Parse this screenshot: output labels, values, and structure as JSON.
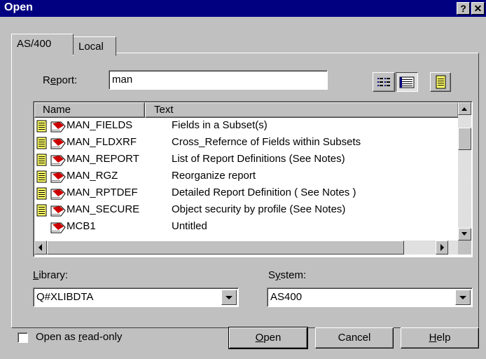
{
  "window": {
    "title": "Open",
    "help_glyph": "?",
    "close_glyph": "✕"
  },
  "tabs": [
    {
      "label": "AS/400"
    },
    {
      "label": "Local"
    }
  ],
  "report": {
    "label_pre": "R",
    "label_ul": "e",
    "label_post": "port:",
    "value": "man"
  },
  "view_icons": [
    "list-view-icon",
    "details-view-icon",
    "properties-icon"
  ],
  "list": {
    "headers": {
      "name": "Name",
      "text": "Text"
    },
    "rows": [
      {
        "name": "MAN_FIELDS",
        "text": "Fields in a Subset(s)"
      },
      {
        "name": "MAN_FLDXRF",
        "text": "Cross_Refernce of Fields within Subsets"
      },
      {
        "name": "MAN_REPORT",
        "text": "List of Report Definitions   (See Notes)"
      },
      {
        "name": "MAN_RGZ",
        "text": "Reorganize report"
      },
      {
        "name": "MAN_RPTDEF",
        "text": "Detailed Report Definition ( See Notes )"
      },
      {
        "name": "MAN_SECURE",
        "text": "Object security by profile (See Notes)"
      },
      {
        "name": "MCB1",
        "text": "Untitled"
      }
    ]
  },
  "library": {
    "label_ul": "L",
    "label_post": "ibrary:",
    "value": "Q#XLIBDTA"
  },
  "system": {
    "label_pre": "S",
    "label_ul": "y",
    "label_post": "stem:",
    "value": "AS400"
  },
  "readonly": {
    "label_pre": "Open as ",
    "label_ul": "r",
    "label_post": "ead-only",
    "checked": false
  },
  "buttons": {
    "open": {
      "ul": "O",
      "rest": "pen"
    },
    "cancel": {
      "label": "Cancel"
    },
    "help": {
      "ul": "H",
      "rest": "elp"
    }
  }
}
